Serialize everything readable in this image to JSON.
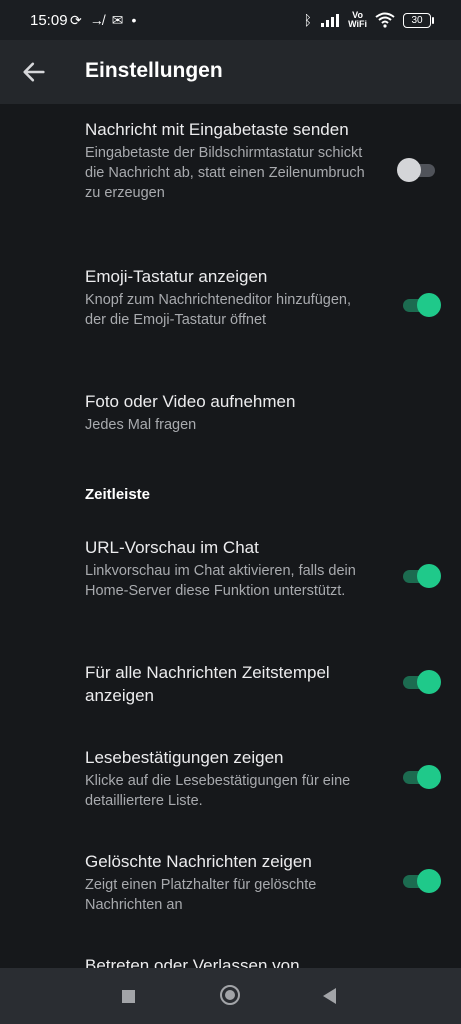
{
  "status": {
    "time": "15:09",
    "battery": "30",
    "left_icons": [
      "sync-icon",
      "call-forward-icon",
      "mail-icon",
      "dot-icon"
    ],
    "right_icons": [
      "bluetooth-icon",
      "signal-icon",
      "vowifi-icon",
      "wifi-icon",
      "battery-icon"
    ],
    "vowifi_top": "Vo",
    "vowifi_bottom": "WiFi"
  },
  "appbar": {
    "title": "Einstellungen",
    "back_icon": "arrow-left-icon"
  },
  "settings": [
    {
      "title": "Nachricht mit Eingabetaste senden",
      "subtitle": "Eingabetaste der Bildschirmtastatur schickt die Nachricht ab, statt einen Zeilenumbruch zu erzeugen",
      "toggle": false
    },
    {
      "title": "Emoji-Tastatur anzeigen",
      "subtitle": "Knopf zum Nachrichteneditor hinzufügen, der die Emoji-Tastatur öffnet",
      "toggle": true
    },
    {
      "title": "Foto oder Video aufnehmen",
      "subtitle": "Jedes Mal fragen"
    }
  ],
  "section_timeline": "Zeitleiste",
  "timeline_settings": [
    {
      "title": "URL-Vorschau im Chat",
      "subtitle": "Linkvorschau im Chat aktivieren, falls dein Home-Server diese Funktion unterstützt.",
      "toggle": true
    },
    {
      "title": "Für alle Nachrichten Zeitstempel anzeigen",
      "toggle": true
    },
    {
      "title": "Lesebestätigungen zeigen",
      "subtitle": "Klicke auf die Lesebestätigungen für eine detailliertere Liste.",
      "toggle": true
    },
    {
      "title": "Gelöschte Nachrichten zeigen",
      "subtitle": "Zeigt einen Platzhalter für gelöschte Nachrichten an",
      "toggle": true
    },
    {
      "title": "Betreten oder Verlassen von"
    }
  ],
  "colors": {
    "accent": "#1fc98a",
    "background": "#16181b",
    "appbar": "#24272b"
  }
}
